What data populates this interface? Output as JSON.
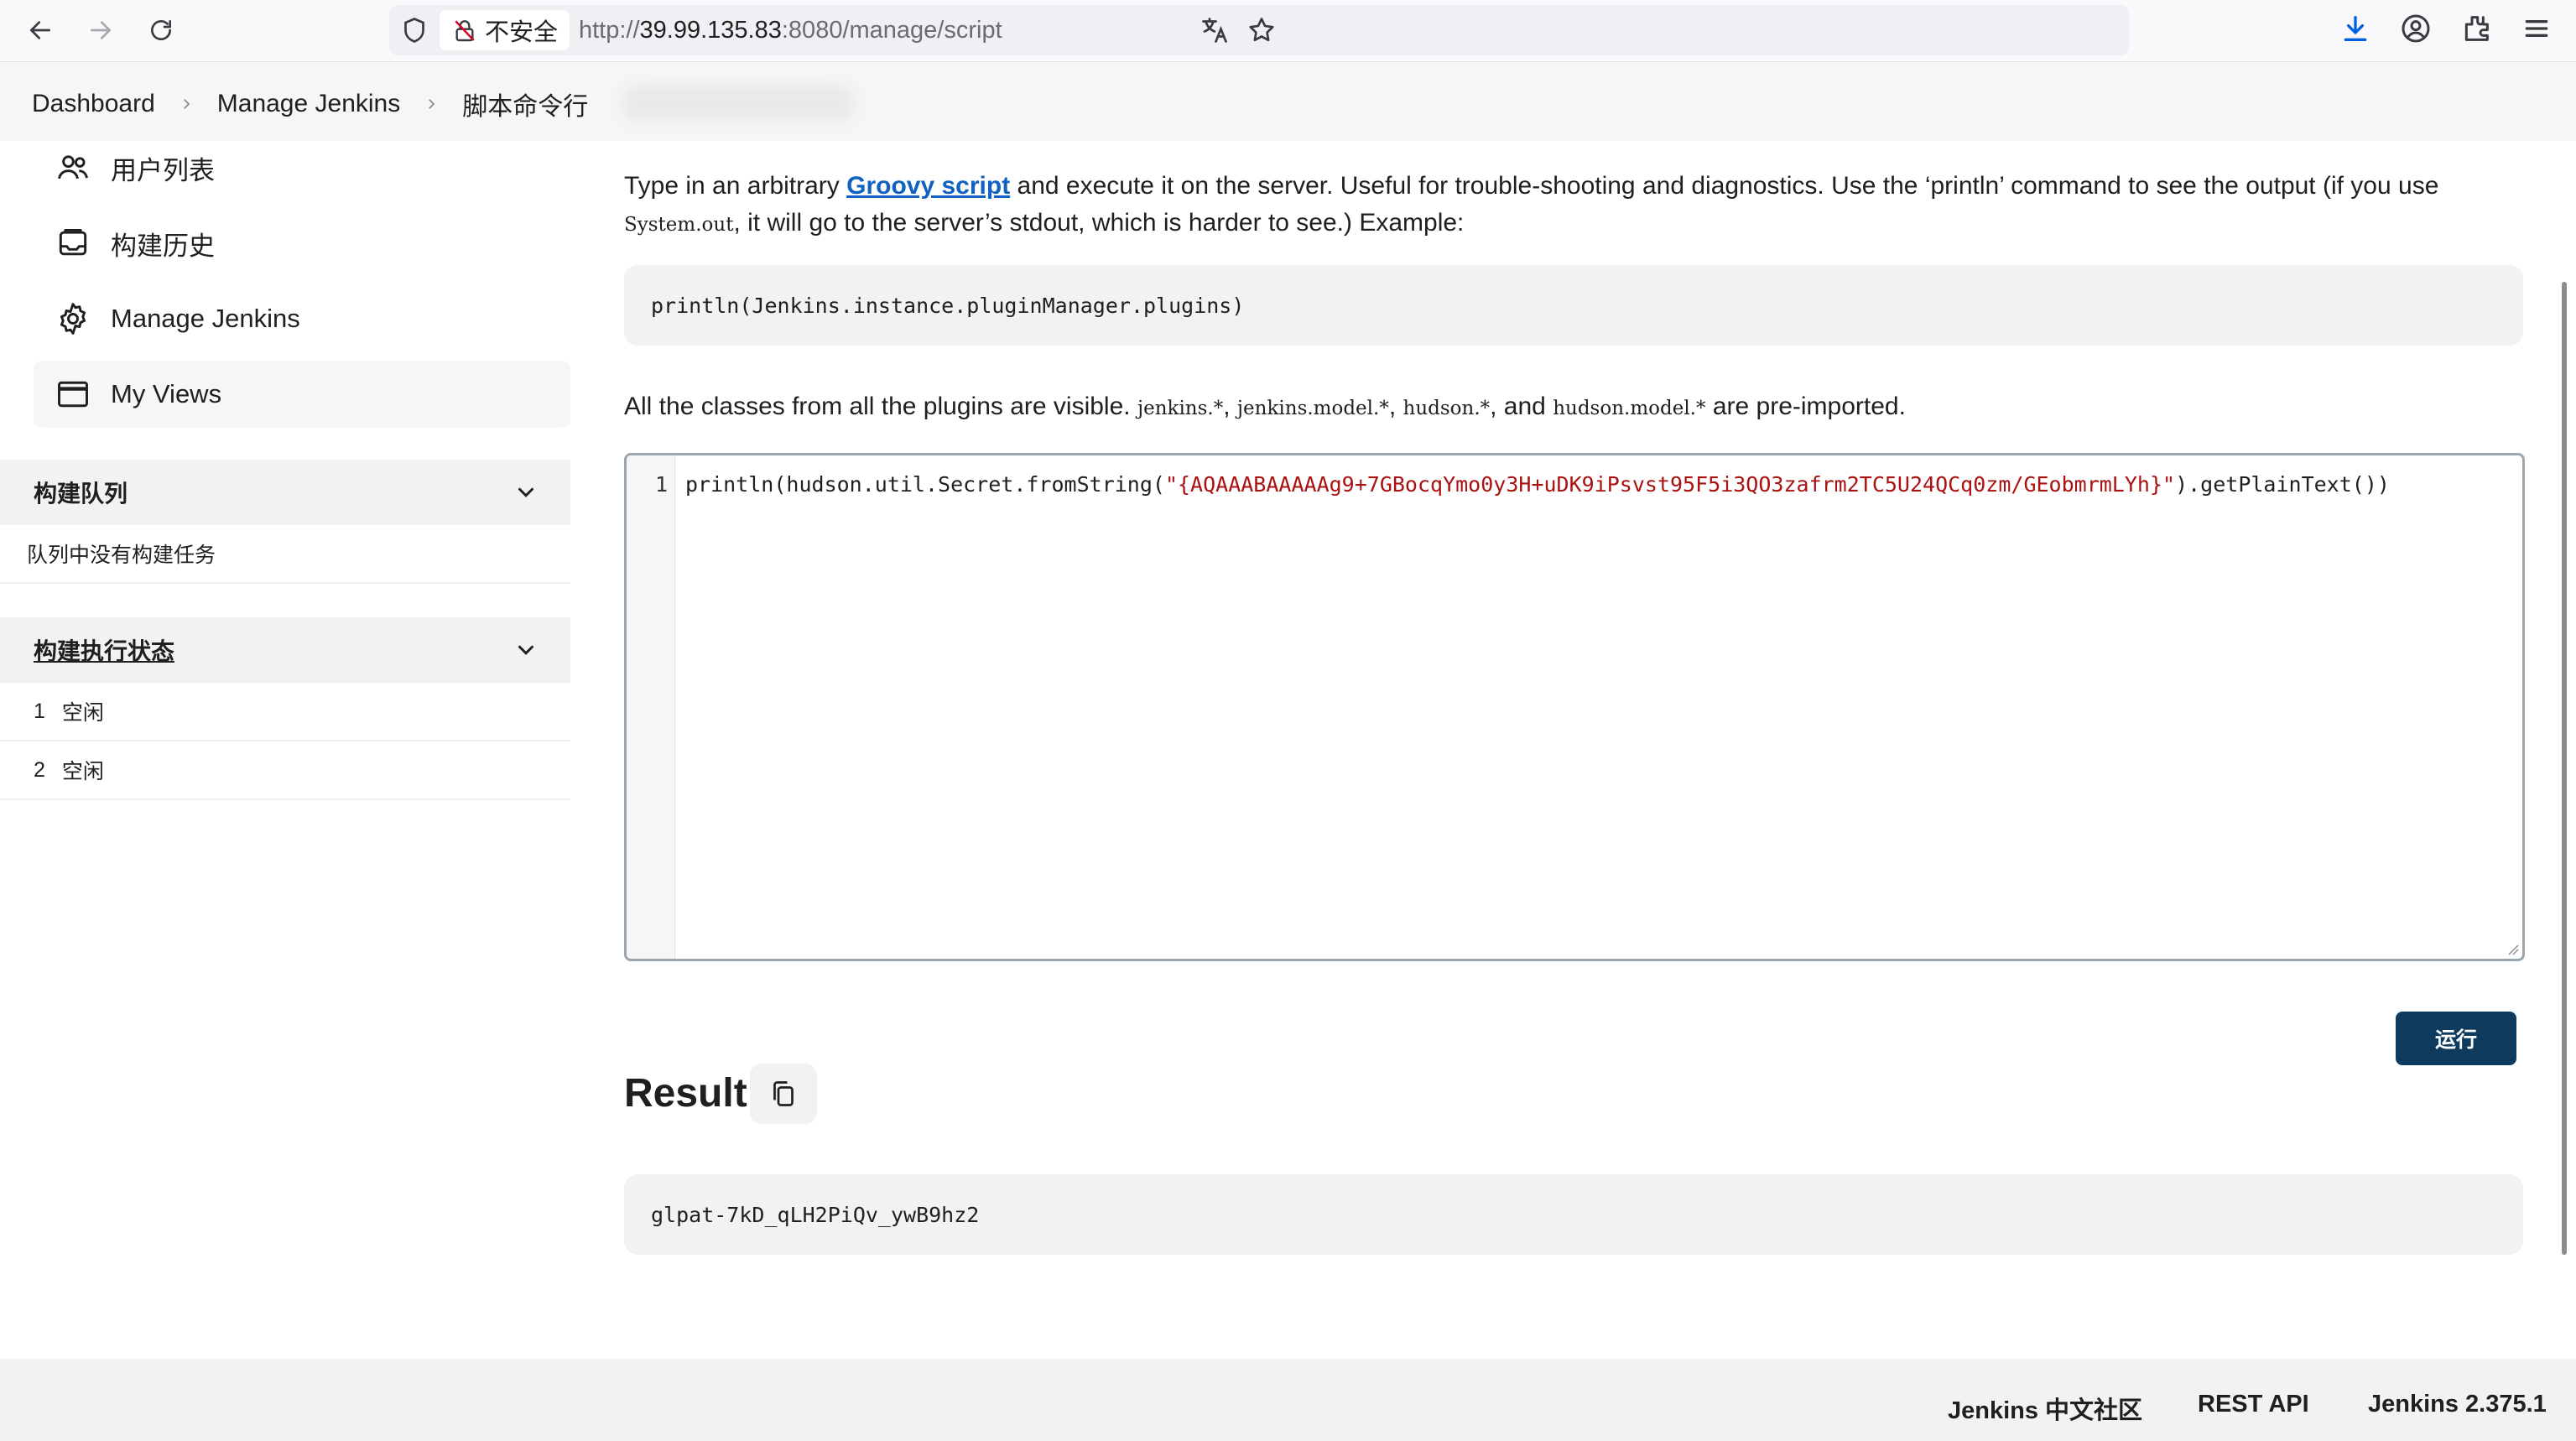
{
  "browser": {
    "security_label": "不安全",
    "url_scheme": "http://",
    "url_host": "39.99.135.83",
    "url_rest": ":8080/manage/script"
  },
  "breadcrumb": {
    "items": [
      "Dashboard",
      "Manage Jenkins",
      "脚本命令行"
    ]
  },
  "sidebar": {
    "tasks": [
      {
        "label": "用户列表",
        "icon": "users-icon"
      },
      {
        "label": "构建历史",
        "icon": "history-icon"
      },
      {
        "label": "Manage Jenkins",
        "icon": "gear-icon"
      },
      {
        "label": "My Views",
        "icon": "window-icon"
      }
    ],
    "build_queue": {
      "title": "构建队列",
      "empty_message": "队列中没有构建任务"
    },
    "executors": {
      "title": "构建执行状态",
      "items": [
        {
          "number": "1",
          "status": "空闲"
        },
        {
          "number": "2",
          "status": "空闲"
        }
      ]
    }
  },
  "main": {
    "intro_before_link": "Type in an arbitrary ",
    "intro_link": "Groovy script",
    "intro_after_link": " and execute it on the server. Useful for trouble-shooting and diagnostics. Use the ‘println’ command to see the output (if you use ",
    "intro_system_out": "System.out",
    "intro_after_system_out": ", it will go to the server’s stdout, which is harder to see.) Example:",
    "example_code": "println(Jenkins.instance.pluginManager.plugins)",
    "classes_prefix": "All the classes from all the plugins are visible. ",
    "classes_pkg1": "jenkins.*",
    "classes_pkg2": "jenkins.model.*",
    "classes_pkg3": "hudson.*",
    "classes_and": ", and ",
    "classes_pkg4": "hudson.model.*",
    "classes_suffix": " are pre-imported.",
    "editor": {
      "line_number": "1",
      "code_before": "println(hudson.util.Secret.fromString(",
      "code_string": "\"{AQAAABAAAAAg9+7GBocqYmo0y3H+uDK9iPsvst95F5i3QO3zafrm2TC5U24QCq0zm/GEobmrmLYh}\"",
      "code_after": ").getPlainText())"
    },
    "run_button": "运行",
    "result_title": "Result",
    "result_text": "glpat-7kD_qLH2PiQv_ywB9hz2"
  },
  "footer": {
    "community": "Jenkins 中文社区",
    "rest_api": "REST API",
    "version": "Jenkins 2.375.1"
  },
  "colors": {
    "link": "#1161c1",
    "run_button": "#0e3a5e",
    "code_string": "#aa1111"
  }
}
